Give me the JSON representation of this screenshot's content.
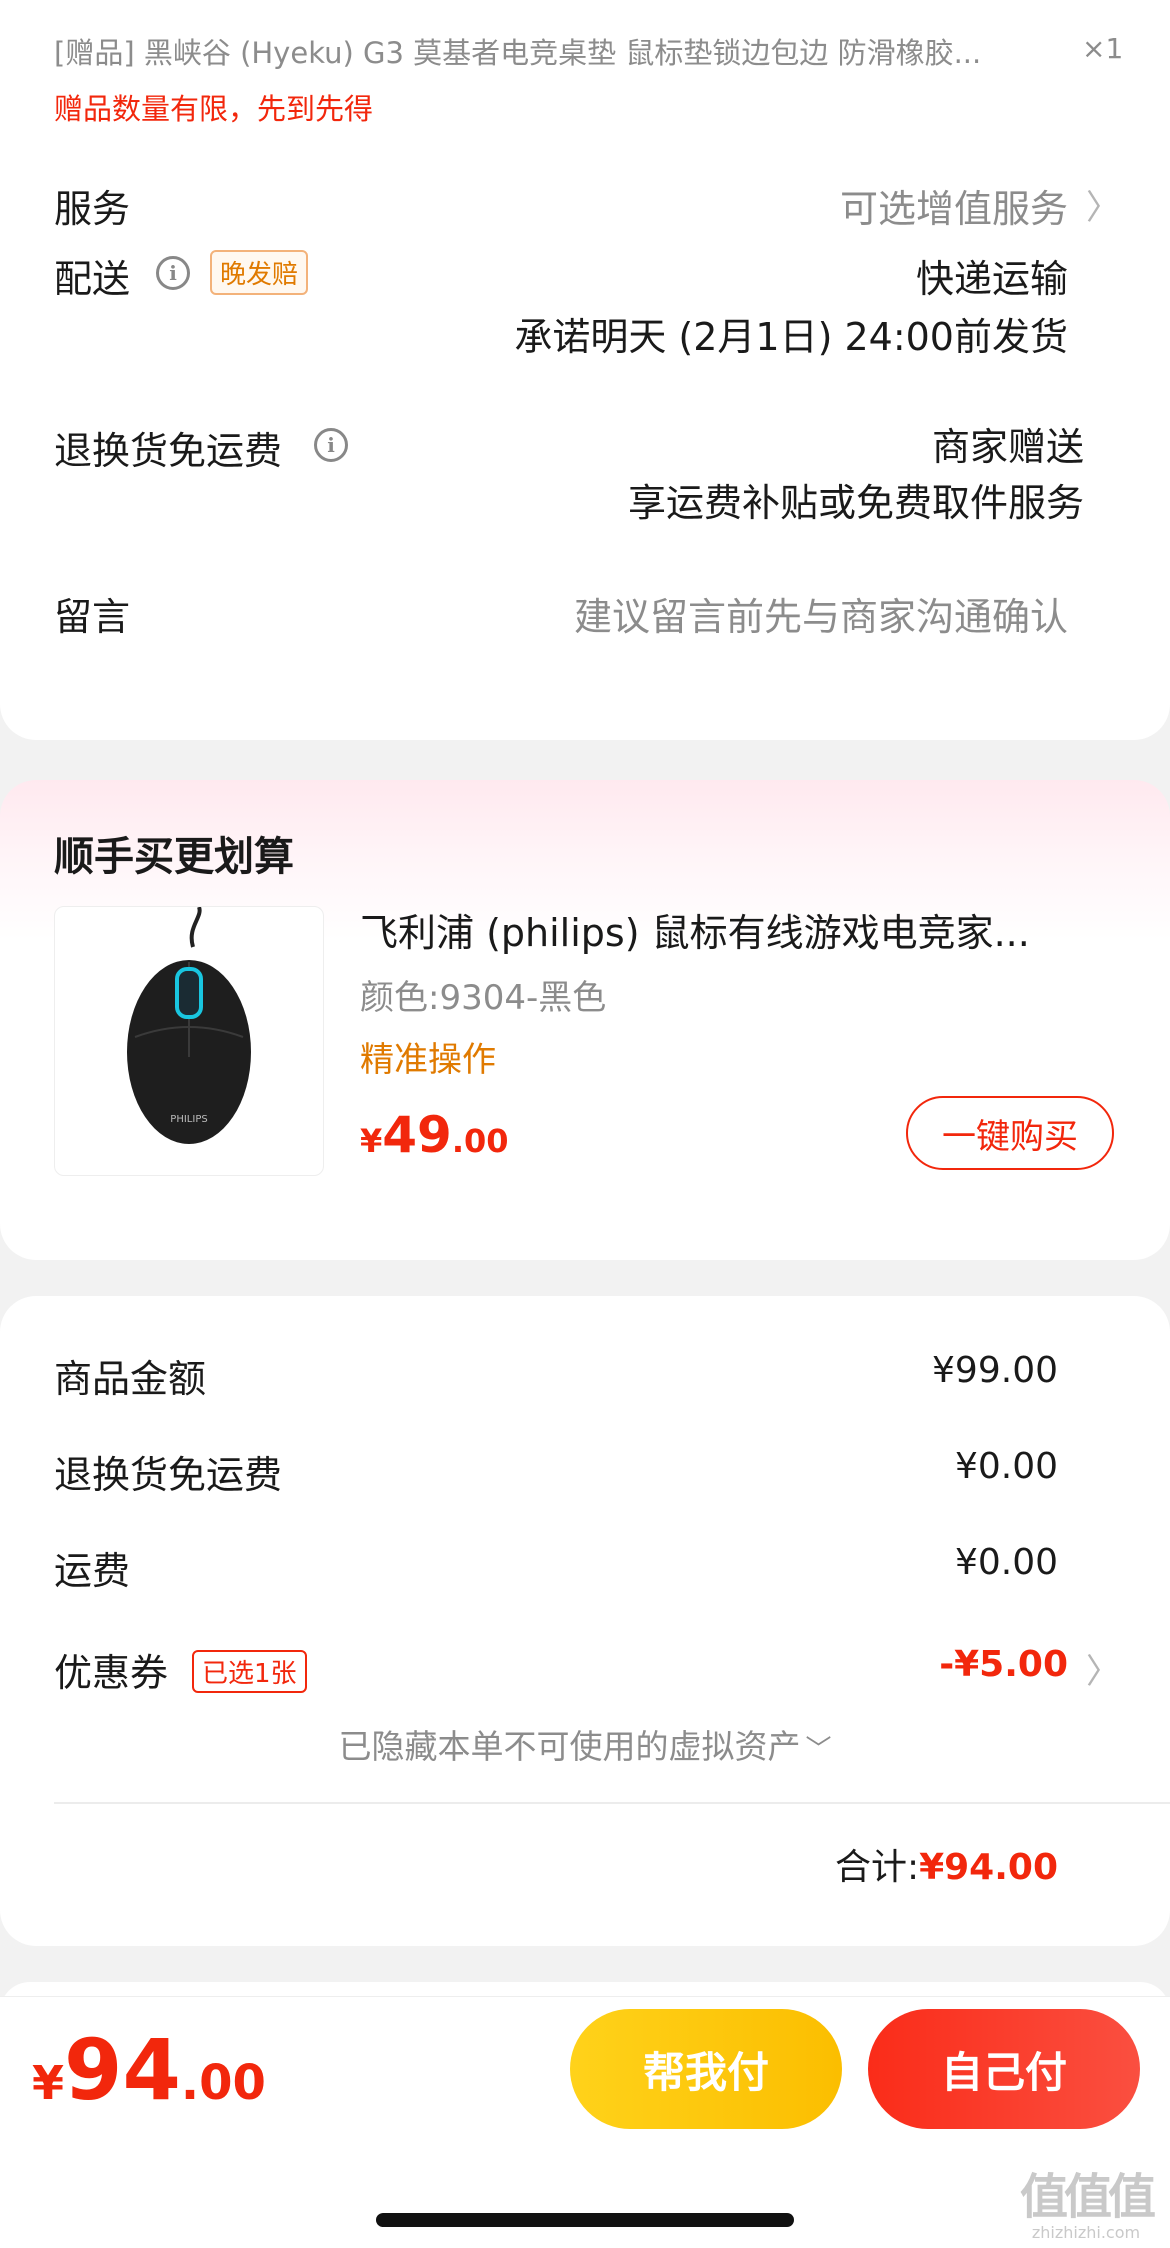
{
  "gift": {
    "title": "[赠品] 黑峡谷 (Hyeku) G3 莫基者电竞桌垫 鼠标垫锁边包边 防滑橡胶...",
    "qty": "×1",
    "notice": "赠品数量有限，先到先得"
  },
  "rows": {
    "service": {
      "label": "服务",
      "value": "可选增值服务"
    },
    "delivery": {
      "label": "配送",
      "tag": "晚发赔",
      "value1": "快递运输",
      "value2": "承诺明天 (2月1日) 24:00前发货"
    },
    "return_shipping": {
      "label": "退换货免运费",
      "value1": "商家赠送",
      "value2": "享运费补贴或免费取件服务"
    },
    "message": {
      "label": "留言",
      "placeholder": "建议留言前先与商家沟通确认"
    }
  },
  "addon": {
    "section_title": "顺手买更划算",
    "product": {
      "name": "飞利浦 (philips) 鼠标有线游戏电竞家...",
      "variant": "颜色:9304-黑色",
      "highlight": "精准操作",
      "currency": "¥",
      "price_int": "49",
      "price_dec": ".00",
      "button": "一键购买",
      "image_brand": "PHILIPS"
    }
  },
  "summary": {
    "goods_amount": {
      "label": "商品金额",
      "value": "¥99.00"
    },
    "return_fee": {
      "label": "退换货免运费",
      "value": "¥0.00"
    },
    "shipping": {
      "label": "运费",
      "value": "¥0.00"
    },
    "coupon": {
      "label": "优惠券",
      "tag": "已选1张",
      "value": "-¥5.00"
    },
    "hidden_assets": "已隐藏本单不可使用的虚拟资产",
    "total_label": "合计:",
    "total_value": "¥94.00"
  },
  "bottom_bar": {
    "currency": "¥",
    "price_int": "94",
    "price_dec": ".00",
    "help_pay": "帮我付",
    "self_pay": "自己付"
  },
  "watermark": {
    "text": "值值值",
    "url": "zhizhizhi.com"
  },
  "icons": [
    "info-icon",
    "chevron-right-icon",
    "chevron-down-icon"
  ],
  "colors": {
    "accent_red": "#f2270c",
    "orange": "#e07a00",
    "help_pay_yellow": "#fbc400",
    "self_pay_red": "#f23030"
  }
}
